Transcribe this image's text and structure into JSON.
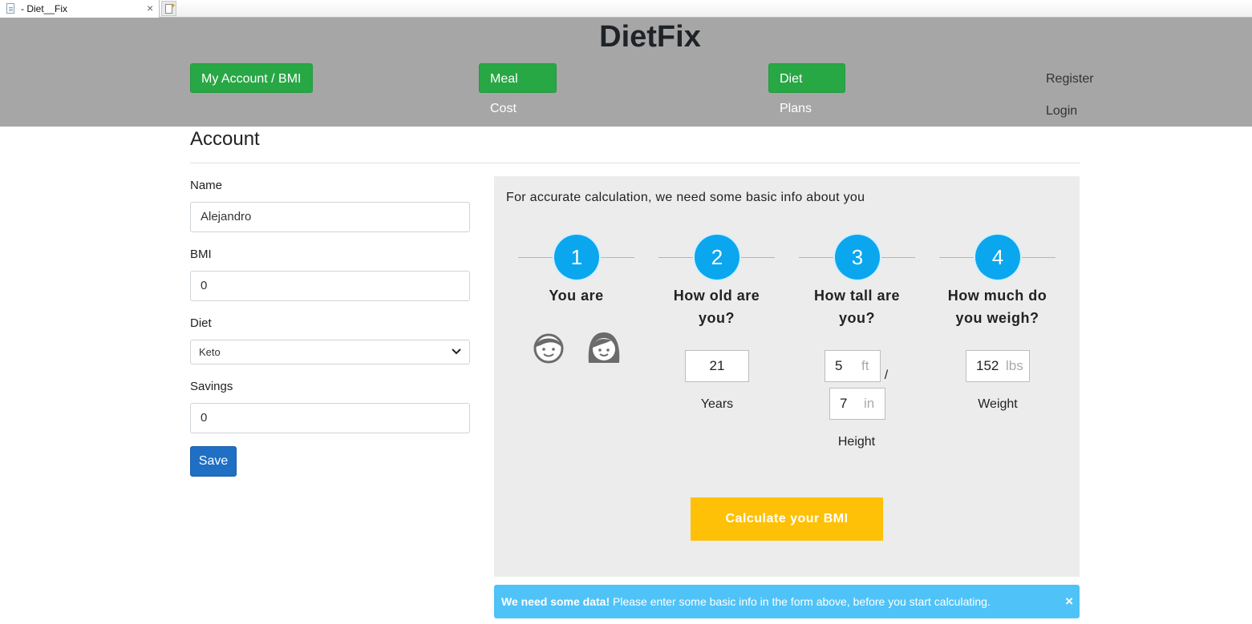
{
  "browser": {
    "tab_title": "- Diet__Fix",
    "close_glyph": "×"
  },
  "header": {
    "brand": "DietFix",
    "nav": {
      "account": "My Account / BMI",
      "meal_cost": "Meal Cost",
      "diet_plans": "Diet Plans",
      "register": "Register",
      "login": "Login"
    },
    "colors": {
      "background": "#a6a6a6",
      "nav_button": "#28a745"
    }
  },
  "account": {
    "heading": "Account",
    "name": {
      "label": "Name",
      "value": "Alejandro"
    },
    "bmi": {
      "label": "BMI",
      "value": "0"
    },
    "diet": {
      "label": "Diet",
      "selected": "Keto"
    },
    "savings": {
      "label": "Savings",
      "value": "0"
    },
    "save_label": "Save"
  },
  "bmi_panel": {
    "intro": "For accurate calculation, we need some basic info about you",
    "steps": [
      {
        "number": "1",
        "title": "You are"
      },
      {
        "number": "2",
        "title": "How old are you?"
      },
      {
        "number": "3",
        "title": "How tall are you?"
      },
      {
        "number": "4",
        "title": "How much do you weigh?"
      }
    ],
    "gender_icons": [
      "male-face-icon",
      "female-face-icon"
    ],
    "age": {
      "value": "21",
      "caption": "Years"
    },
    "height": {
      "feet": "5",
      "feet_unit": "ft",
      "separator": "/",
      "inches": "7",
      "inches_unit": "in",
      "caption": "Height"
    },
    "weight": {
      "value": "152",
      "unit": "lbs",
      "caption": "Weight"
    },
    "calculate_label": "Calculate your BMI",
    "colors": {
      "step_circle": "#0aa7ef",
      "calculate_button": "#ffc107",
      "panel": "#ececec"
    }
  },
  "alert": {
    "strong": "We need some data!",
    "message": " Please enter some basic info in the form above, before you start calculating.",
    "close_glyph": "×",
    "color": "#4fc3f7"
  }
}
